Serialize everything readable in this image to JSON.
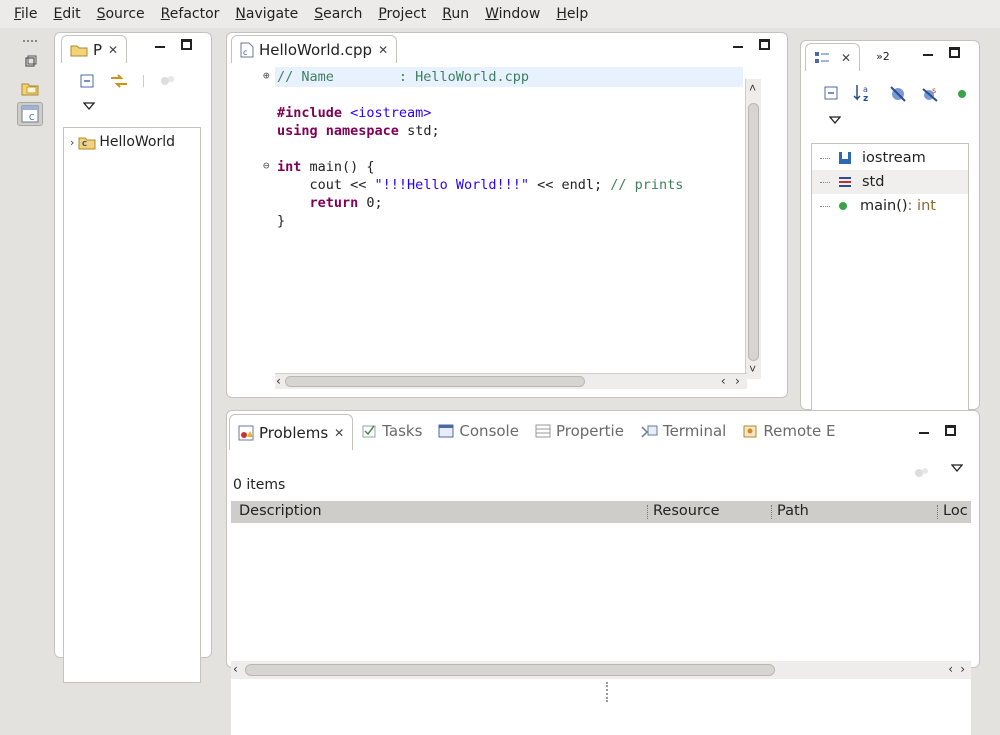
{
  "menubar": {
    "items": [
      "File",
      "Edit",
      "Source",
      "Refactor",
      "Navigate",
      "Search",
      "Project",
      "Run",
      "Window",
      "Help"
    ]
  },
  "project_explorer": {
    "tab_label": "P",
    "tree": [
      {
        "label": "HelloWorld"
      }
    ]
  },
  "editor": {
    "tab_label": "HelloWorld.cpp",
    "lines": {
      "l1": "// Name        : HelloWorld.cpp",
      "l2_kw": "#include",
      "l2_rest": " <iostream>",
      "l3_kw1": "using",
      "l3_kw2": "namespace",
      "l3_rest": " std;",
      "l5_kw": "int",
      "l5_rest": " main() {",
      "l6_a": "    cout << ",
      "l6_str": "\"!!!Hello World!!!\"",
      "l6_b": " << endl; ",
      "l6_cm": "// prints",
      "l7_kw": "return",
      "l7_rest": " 0;",
      "l8": "}"
    }
  },
  "outline": {
    "tab_badge": "»2",
    "items": [
      {
        "label": "iostream",
        "type": ""
      },
      {
        "label": "std",
        "type": ""
      },
      {
        "label": "main()",
        "type": " : int"
      }
    ]
  },
  "bottom": {
    "tabs": [
      "Problems",
      "Tasks",
      "Console",
      "Propertie",
      "Terminal",
      "Remote E"
    ],
    "items_count": "0 items",
    "columns": [
      "Description",
      "Resource",
      "Path",
      "Loc"
    ]
  },
  "colors": {
    "keyword": "#7f0055",
    "comment": "#3f7f5f",
    "string": "#2a00ff",
    "background": "#e4e2df"
  }
}
